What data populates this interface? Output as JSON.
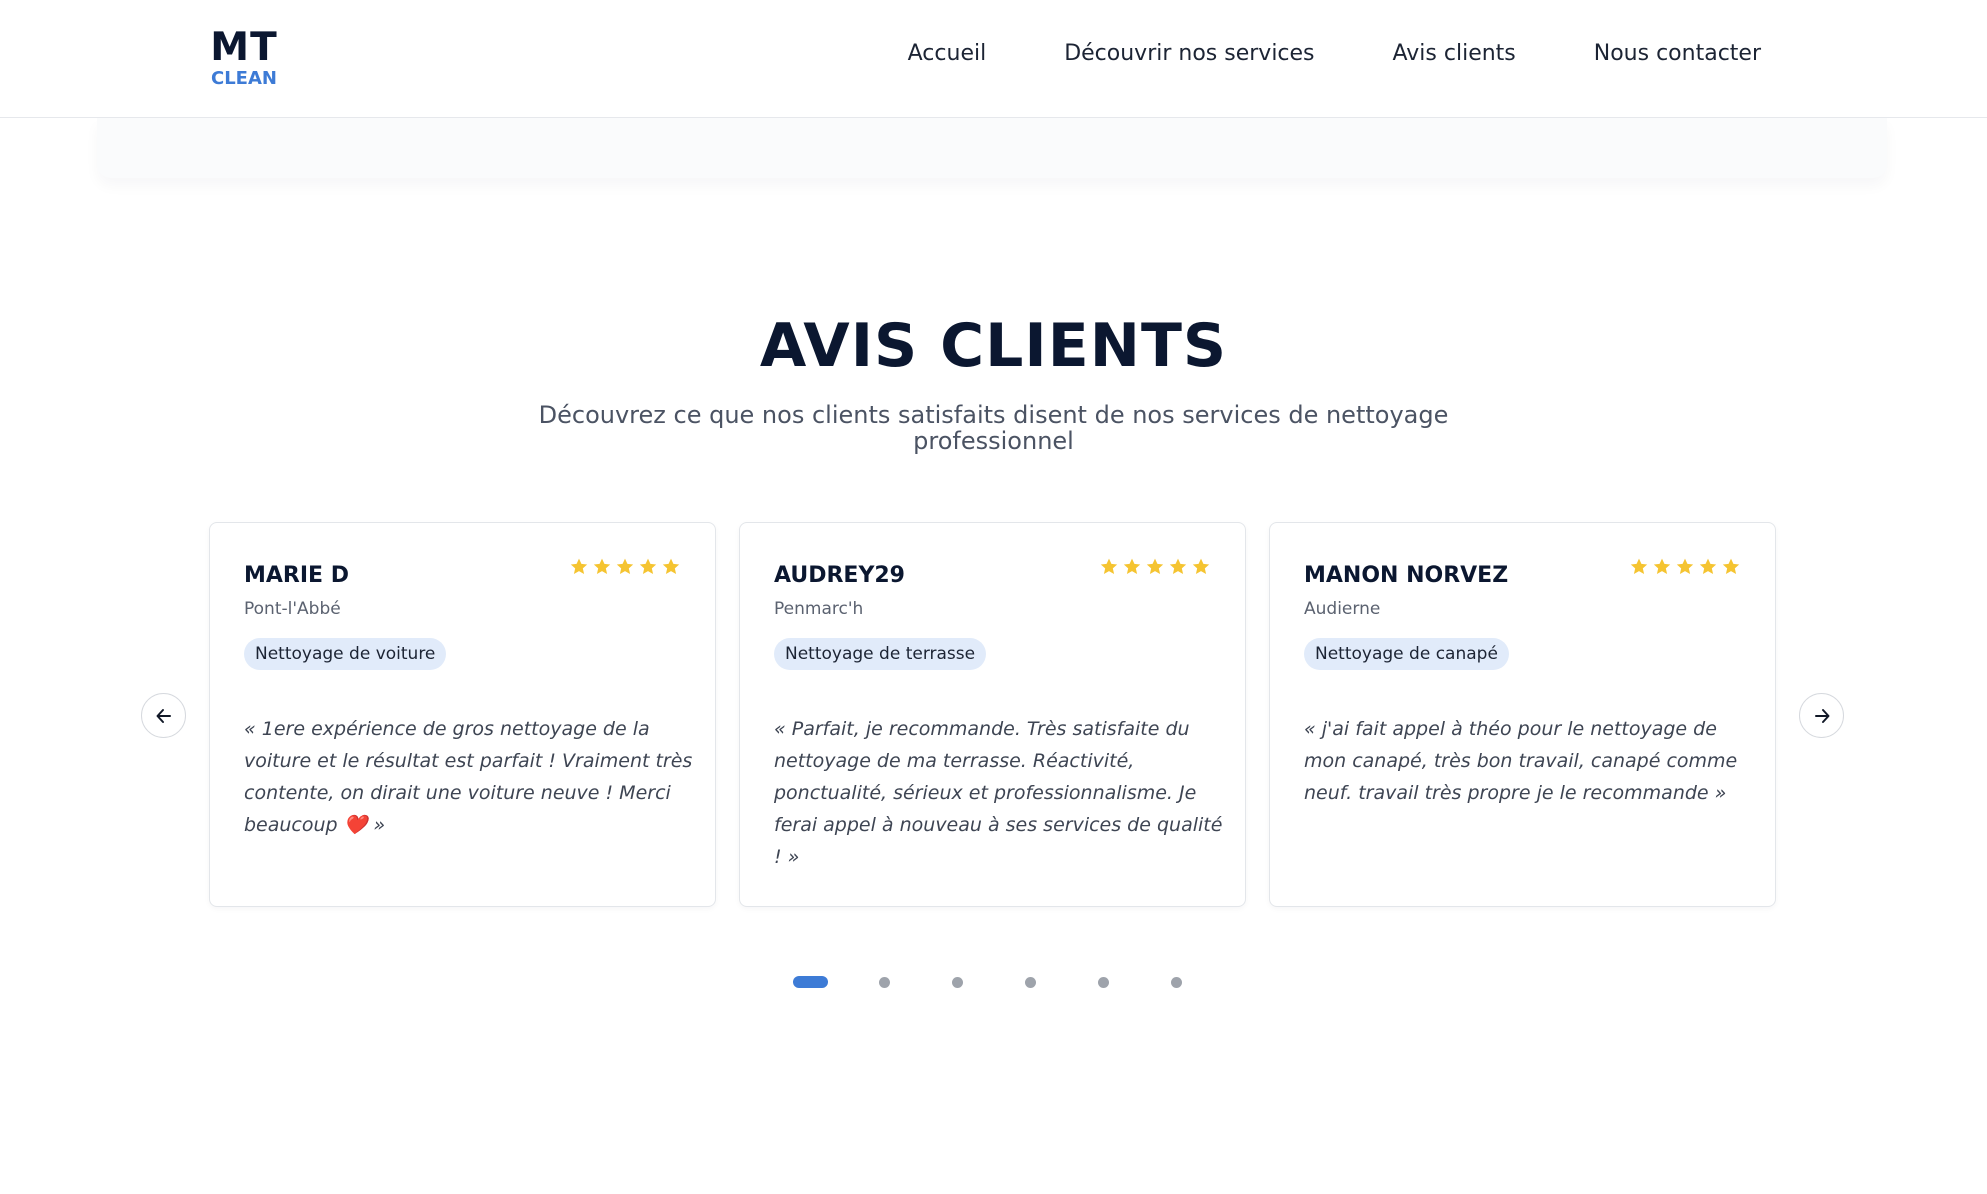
{
  "header": {
    "logo_main": "MT",
    "logo_sub": "CLEAN",
    "nav": [
      "Accueil",
      "Découvrir nos services",
      "Avis clients",
      "Nous contacter"
    ]
  },
  "section": {
    "title": "AVIS CLIENTS",
    "subtitle": "Découvrez ce que nos clients satisfaits disent de nos services de nettoyage professionnel"
  },
  "carousel": {
    "prev_icon": "arrow-left-icon",
    "next_icon": "arrow-right-icon",
    "reviews": [
      {
        "name": "MARIE D",
        "city": "Pont-l'Abbé",
        "rating": 5,
        "service": "Nettoyage de voiture",
        "quote": "« 1ere expérience de gros nettoyage de la voiture et le résultat est parfait ! Vraiment très contente, on dirait une voiture neuve ! Merci beaucoup ❤️ »"
      },
      {
        "name": "AUDREY29",
        "city": "Penmarc'h",
        "rating": 5,
        "service": "Nettoyage de terrasse",
        "quote": "« Parfait, je recommande. Très satisfaite du nettoyage de ma terrasse. Réactivité, ponctualité, sérieux et professionnalisme. Je ferai appel à nouveau à ses services de qualité ! »"
      },
      {
        "name": "MANON NORVEZ",
        "city": "Audierne",
        "rating": 5,
        "service": "Nettoyage de canapé",
        "quote": "« j'ai fait appel à théo pour le nettoyage de mon canapé, très bon travail, canapé comme neuf. travail très propre je le recommande »"
      }
    ],
    "page_count": 6,
    "active_page": 1
  },
  "colors": {
    "brand_dark": "#0b1730",
    "brand_blue": "#3d7bd6",
    "star": "#f5c431",
    "tag_bg": "#e1ebfa"
  }
}
